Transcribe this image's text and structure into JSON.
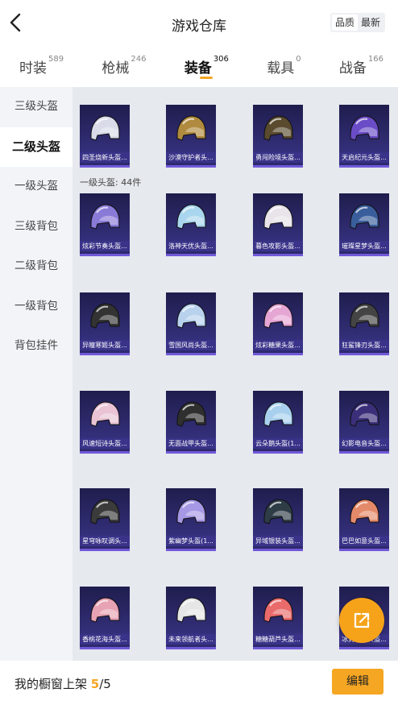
{
  "header": {
    "title": "游戏仓库",
    "sort_quality": "品质",
    "sort_latest": "最新"
  },
  "tabs": [
    {
      "label": "时装",
      "count": "589"
    },
    {
      "label": "枪械",
      "count": "246"
    },
    {
      "label": "装备",
      "count": "306"
    },
    {
      "label": "载具",
      "count": "0"
    },
    {
      "label": "战备",
      "count": "166"
    }
  ],
  "sidebar": {
    "items": [
      "三级头盔",
      "二级头盔",
      "一级头盔",
      "三级背包",
      "二级背包",
      "一级背包",
      "背包挂件"
    ]
  },
  "main": {
    "top_row": [
      "四圣烧新头盔...",
      "沙漠守护者头...",
      "勇闯险境头盔...",
      "天启纪元头盔..."
    ],
    "section_label": "一级头盔: 44件",
    "grid_rows": [
      [
        "炫彩节奏头盔...",
        "洛神天优头盔...",
        "暮色攻影头盔...",
        "璀璨星梦头盔..."
      ],
      [
        "异瞳寒姬头盔...",
        "雪国风尚头盔...",
        "炫彩糖果头盔...",
        "狂鲨锋刃头盔..."
      ],
      [
        "风速短诗头盔...",
        "无面战甲头盔...",
        "云朵鹅头盔(1...",
        "幻影电音头盔..."
      ],
      [
        "星穹咏叹调头...",
        "紫幽梦头盔(1...",
        "异域银装头盔...",
        "巴巴如意头盔..."
      ],
      [
        "香桃花海头盔...",
        "未来领航者头...",
        "糖糖葫芦头盔...",
        "冰封王座头盔..."
      ]
    ]
  },
  "footer": {
    "text": "我的橱窗上架 ",
    "count": "5",
    "total": "/5",
    "edit_label": "编辑"
  },
  "colors": {
    "accent": "#f5a623",
    "card": "#2d2a6e",
    "card_border": "#7159d8"
  },
  "icons": {
    "back": "chevron-left-icon",
    "fab": "external-link-icon"
  }
}
